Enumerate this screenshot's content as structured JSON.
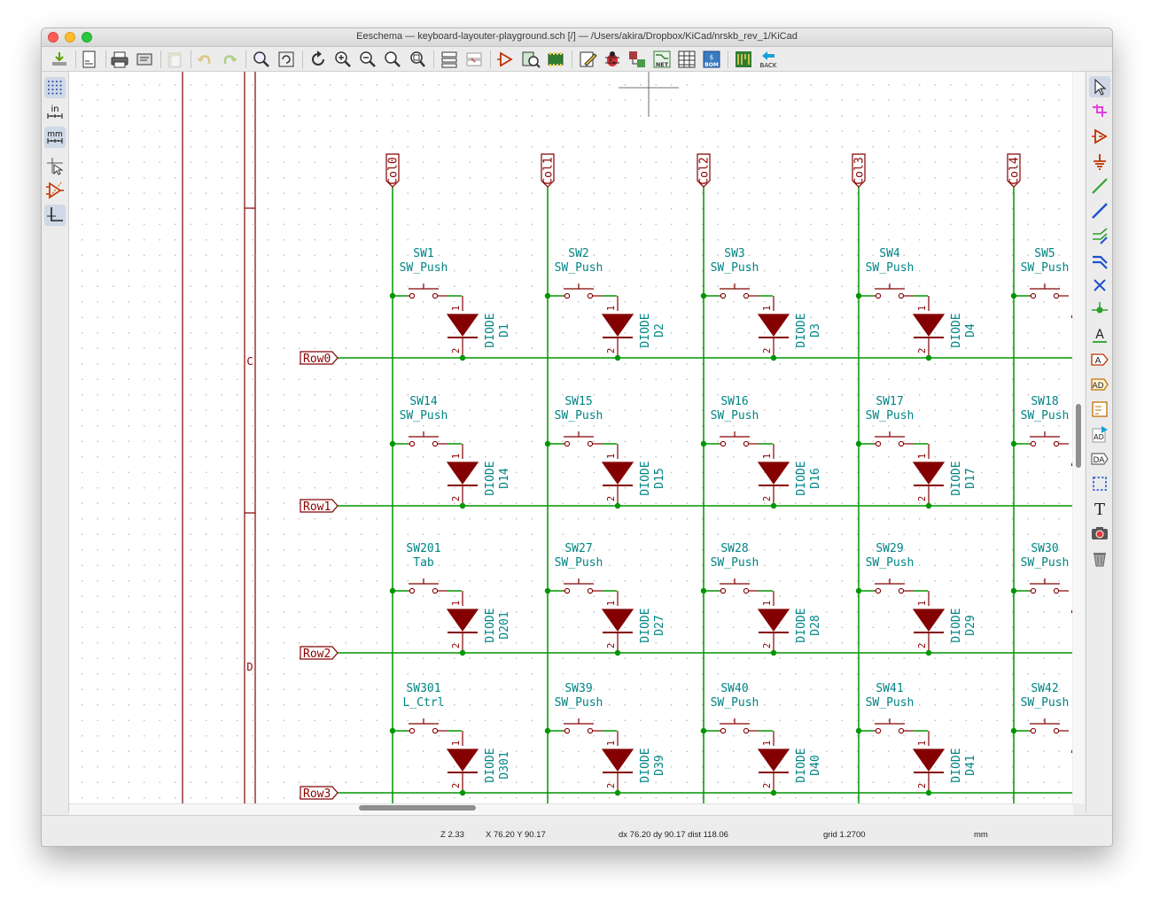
{
  "window": {
    "title": "Eeschema — keyboard-layouter-playground.sch [/] — /Users/akira/Dropbox/KiCad/nrskb_rev_1/KiCad"
  },
  "toolbar": {
    "icons": [
      "save-icon",
      "page-settings-icon",
      "print-icon",
      "plot-icon",
      "paste-icon",
      "undo-icon",
      "redo-icon",
      "find-icon",
      "find-replace-icon",
      "refresh-icon",
      "zoom-in-icon",
      "zoom-out-icon",
      "zoom-fit-icon",
      "zoom-selection-icon",
      "hierarchy-navigator-icon",
      "leave-sheet-icon",
      "library-editor-icon",
      "library-browser-icon",
      "footprint-association-icon",
      "annotate-icon",
      "erc-icon",
      "generate-netlist-icon",
      "netlist-icon",
      "bom-icon",
      "bom-table-icon",
      "pcbnew-icon",
      "back-icon"
    ],
    "back_label": "BACK",
    "net_label": "NET",
    "bom_label": "BOM"
  },
  "left_toolbar": {
    "grid_label": "grid",
    "in_label": "in",
    "mm_label": "mm"
  },
  "frame": {
    "zone_c": "C",
    "zone_d": "D"
  },
  "schematic": {
    "columns": [
      "Col0",
      "Col1",
      "Col2",
      "Col3",
      "Col4"
    ],
    "rows": [
      "Row0",
      "Row1",
      "Row2",
      "Row3"
    ],
    "switches": [
      [
        {
          "ref": "SW1",
          "value": "SW_Push"
        },
        {
          "ref": "SW2",
          "value": "SW_Push"
        },
        {
          "ref": "SW3",
          "value": "SW_Push"
        },
        {
          "ref": "SW4",
          "value": "SW_Push"
        },
        {
          "ref": "SW5",
          "value": "SW_Push"
        }
      ],
      [
        {
          "ref": "SW14",
          "value": "SW_Push"
        },
        {
          "ref": "SW15",
          "value": "SW_Push"
        },
        {
          "ref": "SW16",
          "value": "SW_Push"
        },
        {
          "ref": "SW17",
          "value": "SW_Push"
        },
        {
          "ref": "SW18",
          "value": "SW_Push"
        }
      ],
      [
        {
          "ref": "SW201",
          "value": "Tab"
        },
        {
          "ref": "SW27",
          "value": "SW_Push"
        },
        {
          "ref": "SW28",
          "value": "SW_Push"
        },
        {
          "ref": "SW29",
          "value": "SW_Push"
        },
        {
          "ref": "SW30",
          "value": "SW_Push"
        }
      ],
      [
        {
          "ref": "SW301",
          "value": "L_Ctrl"
        },
        {
          "ref": "SW39",
          "value": "SW_Push"
        },
        {
          "ref": "SW40",
          "value": "SW_Push"
        },
        {
          "ref": "SW41",
          "value": "SW_Push"
        },
        {
          "ref": "SW42",
          "value": "SW_Push"
        }
      ]
    ],
    "diodes": [
      [
        "D1",
        "D2",
        "D3",
        "D4"
      ],
      [
        "D14",
        "D15",
        "D16",
        "D17"
      ],
      [
        "D201",
        "D27",
        "D28",
        "D29"
      ],
      [
        "D301",
        "D39",
        "D40",
        "D41"
      ]
    ],
    "diode_value": "DIODE",
    "pin_1": "1",
    "pin_2": "2",
    "colors": {
      "wire": "#009600",
      "component": "#840000",
      "label": "#840000",
      "reference": "#008484",
      "frame": "#840000"
    }
  },
  "status": {
    "zoom": "Z 2.33",
    "position": "X 76.20  Y 90.17",
    "delta": "dx 76.20  dy 90.17  dist 118.06",
    "grid": "grid 1.2700",
    "units": "mm"
  },
  "right_toolbar": {
    "icons": [
      "select-icon",
      "highlight-net-icon",
      "add-symbol-icon",
      "add-power-icon",
      "add-wire-icon",
      "add-bus-icon",
      "wire-entry-icon",
      "bus-entry-icon",
      "no-connect-icon",
      "junction-icon",
      "net-label-icon",
      "global-label-icon",
      "hierarchical-label-icon",
      "hierarchical-sheet-icon",
      "import-sheet-pin-icon",
      "add-sheet-pin-icon",
      "graphic-line-icon",
      "text-icon",
      "image-icon",
      "delete-icon"
    ],
    "text_glyph": "T",
    "label_glyph": "A"
  }
}
